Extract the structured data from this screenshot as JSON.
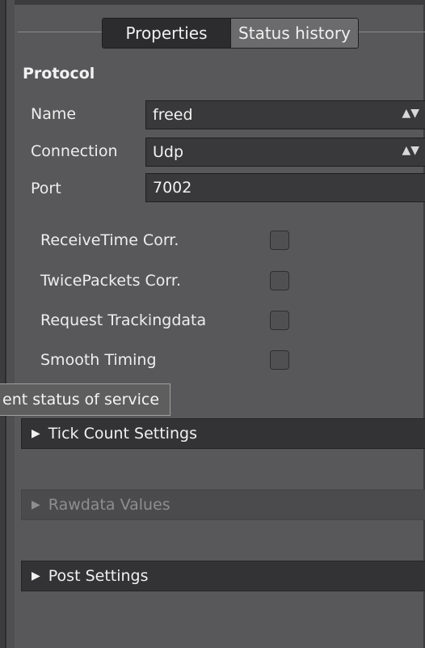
{
  "tabs": [
    {
      "label": "Properties",
      "active": true
    },
    {
      "label": "Status history",
      "active": false
    }
  ],
  "protocol": {
    "title": "Protocol",
    "fields": [
      {
        "label": "Name",
        "value": "freed",
        "spinner": true
      },
      {
        "label": "Connection",
        "value": "Udp",
        "spinner": true
      },
      {
        "label": "Port",
        "value": "7002",
        "spinner": false
      }
    ]
  },
  "checkboxes": [
    {
      "label": "ReceiveTime Corr.",
      "checked": false
    },
    {
      "label": "TwicePackets Corr.",
      "checked": false
    },
    {
      "label": "Request Trackingdata",
      "checked": false
    },
    {
      "label": "Smooth Timing",
      "checked": false
    }
  ],
  "tooltip": "ent status of service",
  "expanders": [
    {
      "label": "Tick Count Settings",
      "enabled": true
    },
    {
      "label": "Rawdata Values",
      "enabled": false
    },
    {
      "label": "Post Settings",
      "enabled": true
    }
  ],
  "icons": {
    "spinner": "up-down-arrow-icon",
    "expander": "triangle-right-icon"
  }
}
